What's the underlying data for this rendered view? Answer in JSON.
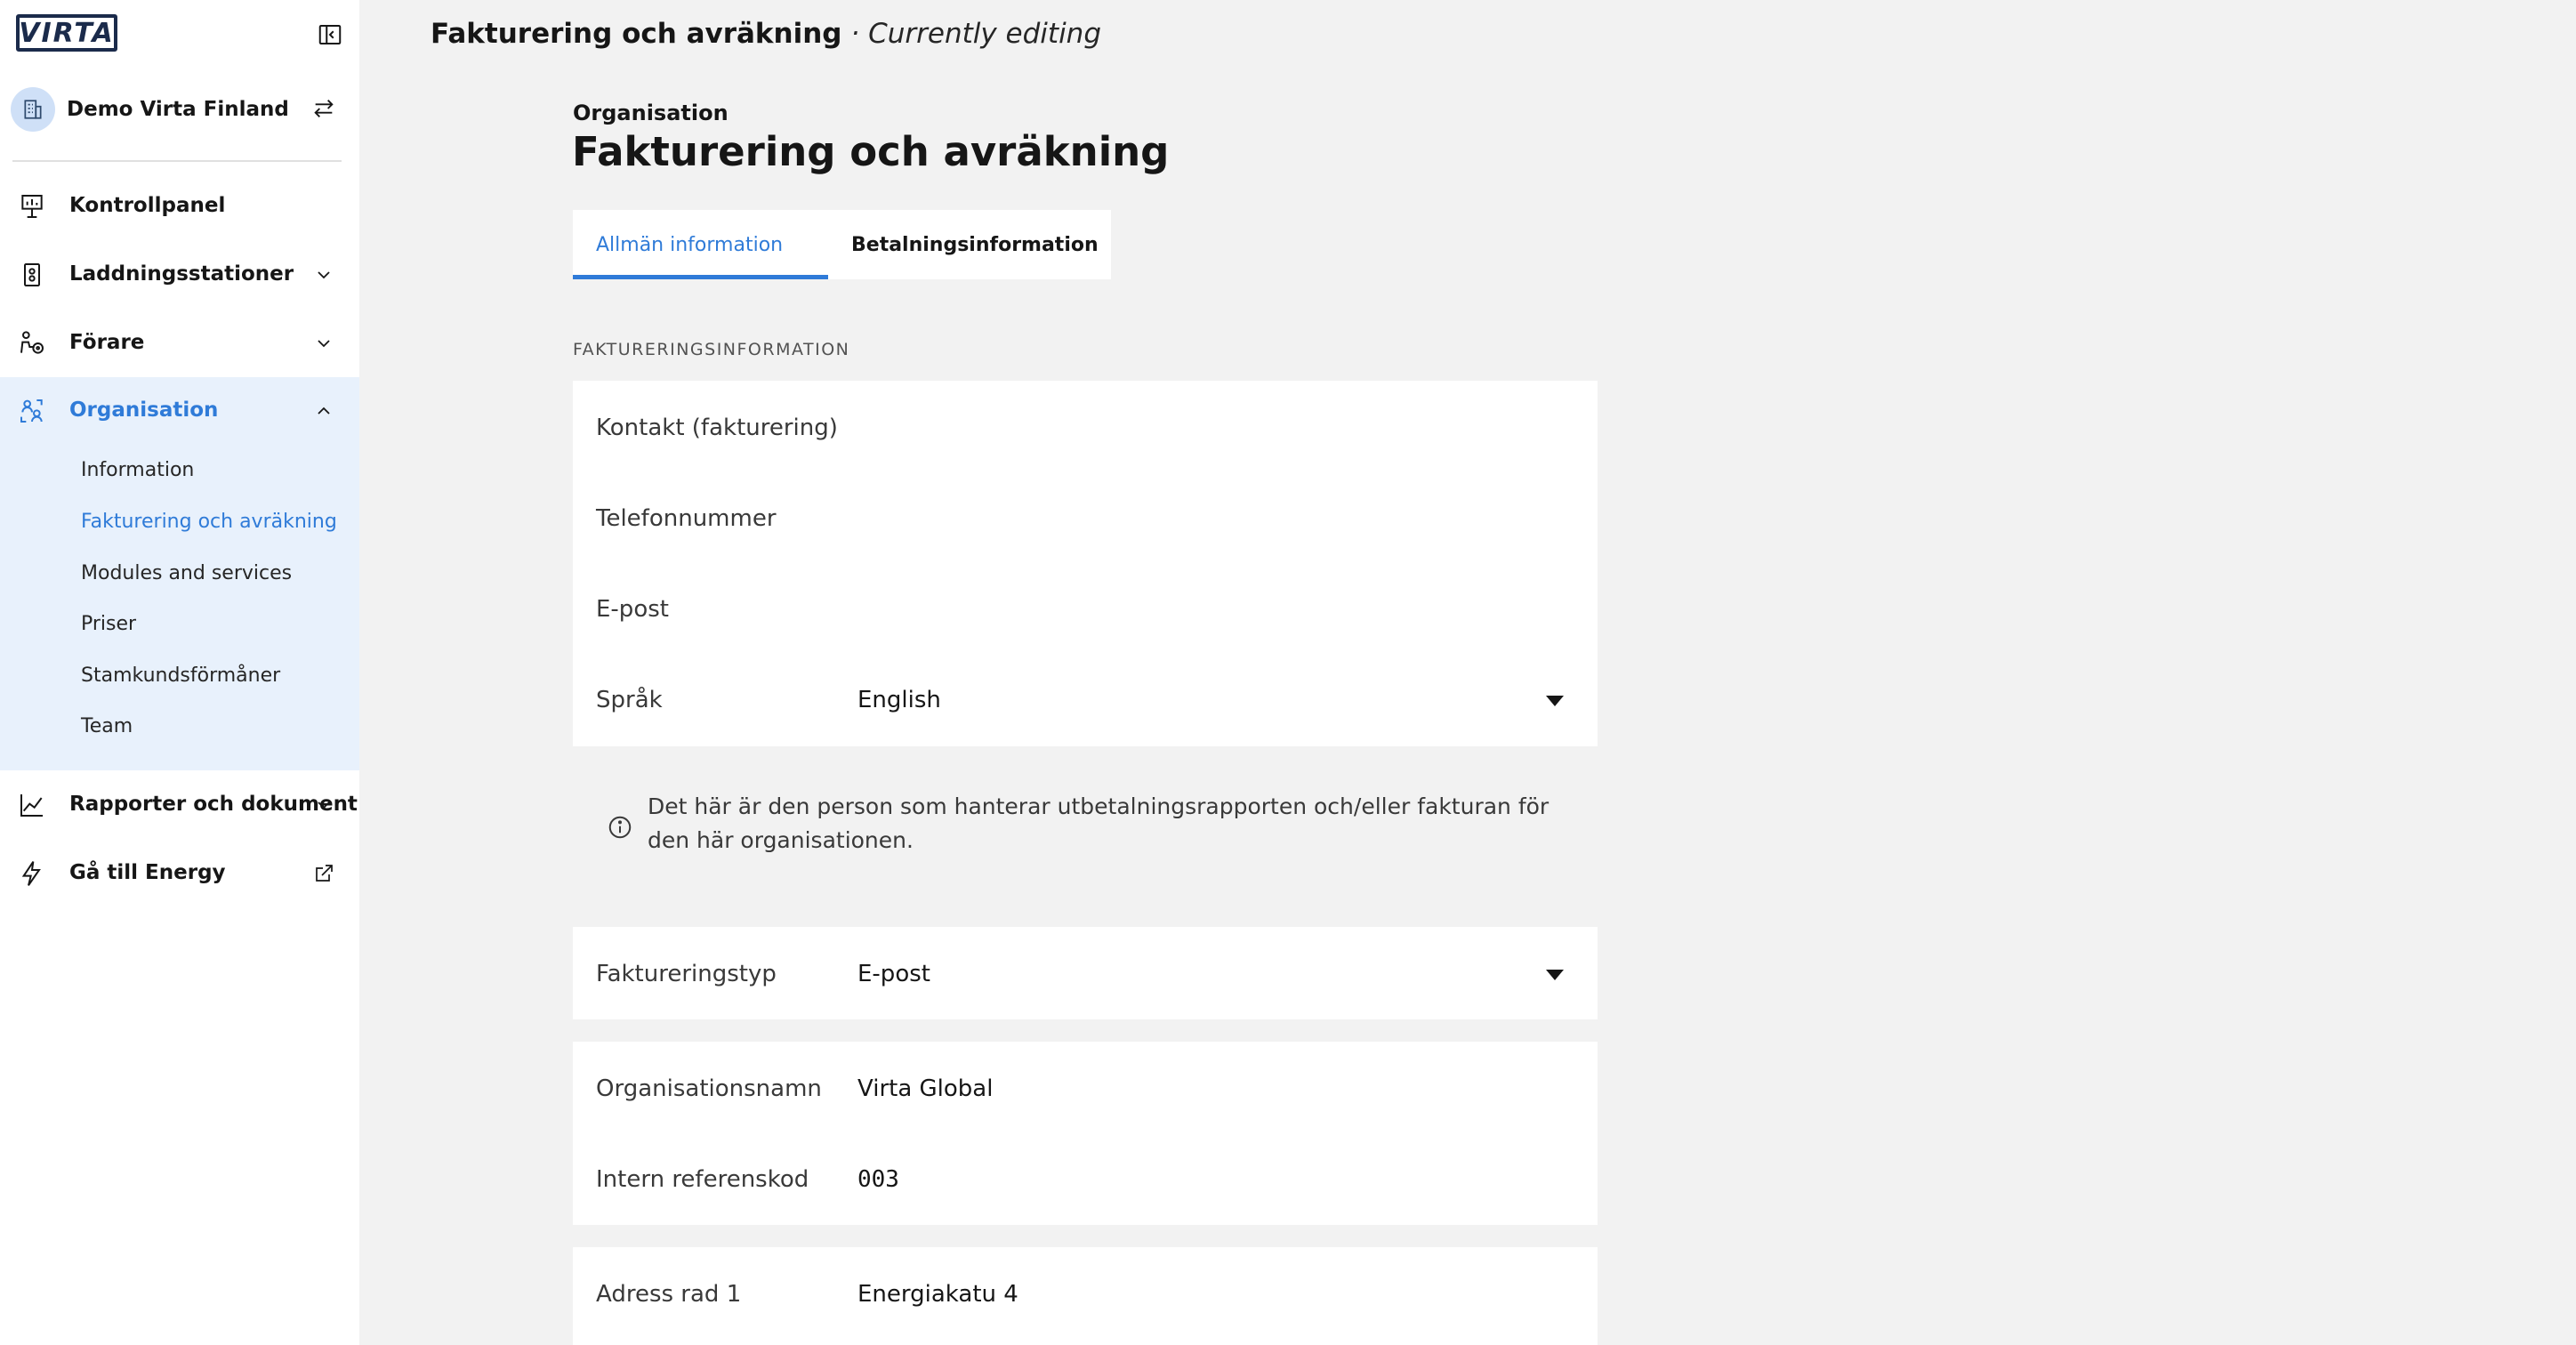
{
  "app": {
    "title": "Fakturering och avräkning",
    "status": "· Currently editing",
    "logo_text": "VIRTA"
  },
  "sidebar": {
    "org_name": "Demo Virta Finland",
    "items": [
      {
        "label": "Kontrollpanel",
        "icon": "dashboard-icon"
      },
      {
        "label": "Laddningsstationer",
        "icon": "charging-station-icon"
      },
      {
        "label": "Förare",
        "icon": "driver-icon"
      },
      {
        "label": "Organisation",
        "icon": "organisation-icon"
      },
      {
        "label": "Rapporter och dokument",
        "icon": "chart-icon"
      },
      {
        "label": "Gå till Energy",
        "icon": "lightning-icon"
      }
    ],
    "sub_items": [
      {
        "label": "Information"
      },
      {
        "label": "Fakturering och avräkning"
      },
      {
        "label": "Modules and services"
      },
      {
        "label": "Priser"
      },
      {
        "label": "Stamkundsförmåner"
      },
      {
        "label": "Team"
      }
    ]
  },
  "main": {
    "breadcrumb": "Organisation",
    "heading": "Fakturering och avräkning",
    "tabs": [
      {
        "label": "Allmän information"
      },
      {
        "label": "Betalningsinformation"
      }
    ],
    "section_title": "FAKTURERINGSINFORMATION",
    "contact_fields": [
      {
        "label": "Kontakt (fakturering)",
        "value": ""
      },
      {
        "label": "Telefonnummer",
        "value": ""
      },
      {
        "label": "E-post",
        "value": ""
      },
      {
        "label": "Språk",
        "value": "English"
      }
    ],
    "info_note": "Det här är den person som hanterar utbetalningsrapporten och/eller fakturan för den här organisationen.",
    "billing_type": {
      "label": "Faktureringstyp",
      "value": "E-post"
    },
    "org_fields": [
      {
        "label": "Organisationsnamn",
        "value": "Virta Global"
      },
      {
        "label": "Intern referenskod",
        "value": "003"
      }
    ],
    "address_fields": [
      {
        "label": "Adress rad 1",
        "value": "Energiakatu 4"
      }
    ]
  },
  "colors": {
    "accent": "#2f7bd8",
    "active_bg": "#e8f1fc",
    "page_bg": "#f2f2f2"
  }
}
